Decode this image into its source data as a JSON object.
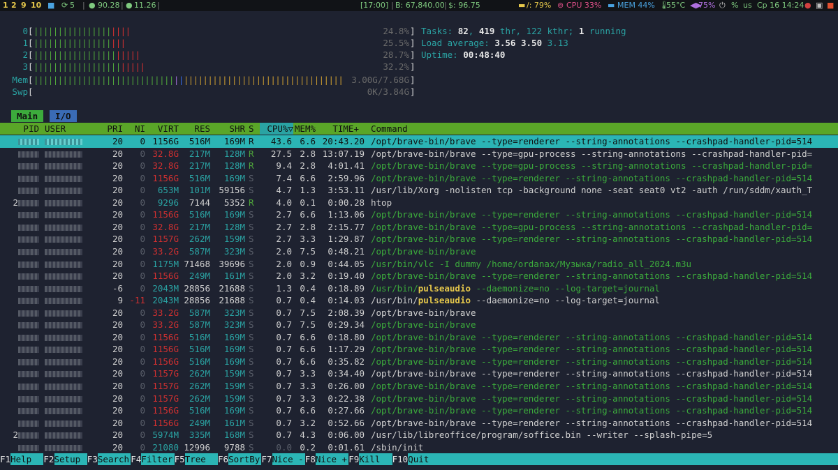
{
  "topbar": {
    "workspaces": [
      "1",
      "2",
      "9",
      "10"
    ],
    "folder_icon": "folder-icon",
    "updates": "5",
    "net_down": "90.28",
    "net_up": "11.26",
    "clock_block": "[17:00]",
    "balance": "B: 67,840.00",
    "price": "$: 96.75",
    "disk": "/: 79%",
    "cpu": "CPU 33%",
    "mem": "MEM 44%",
    "temp": "55°C",
    "battery": "75%",
    "percent_sign": "%",
    "layout": "us",
    "datetime": "Ср 16 14:24"
  },
  "meters": [
    {
      "label": "0",
      "value": "24.8%",
      "green": 16,
      "red": 4,
      "blue": 0,
      "yellow": 0
    },
    {
      "label": "1",
      "value": "25.5%",
      "green": 16,
      "red": 3,
      "blue": 0,
      "yellow": 0
    },
    {
      "label": "2",
      "value": "28.7%",
      "green": 17,
      "red": 5,
      "blue": 0,
      "yellow": 0
    },
    {
      "label": "3",
      "value": "32.2%",
      "green": 18,
      "red": 5,
      "blue": 0,
      "yellow": 0
    },
    {
      "label": "Mem",
      "value": "3.00G/7.68G",
      "green": 29,
      "red": 0,
      "blue": 1,
      "yellow": 33
    },
    {
      "label": "Swp",
      "value": "0K/3.84G",
      "green": 0,
      "red": 0,
      "blue": 0,
      "yellow": 0
    }
  ],
  "info": {
    "tasks_label": "Tasks: ",
    "tasks": "82",
    "thr": "419",
    "kthr": "122",
    "running": "1",
    "load_label": "Load average: ",
    "load1": "3.56",
    "load5": "3.50",
    "load15": "3.13",
    "uptime_label": "Uptime: ",
    "uptime": "00:48:40"
  },
  "tabs": {
    "main": "Main",
    "io": "I/O"
  },
  "header": {
    "pid": "PID",
    "user": "USER",
    "pri": "PRI",
    "ni": "NI",
    "virt": "VIRT",
    "res": "RES",
    "shr": "SHR",
    "s": "S",
    "cpu": "CPU%▽",
    "mem": "MEM%",
    "time": "TIME+",
    "cmd": "Command"
  },
  "processes": [
    {
      "pri": "20",
      "ni": "0",
      "virt": "1156G",
      "res": "516M",
      "shr": "169M",
      "s": "R",
      "cpu": "43.6",
      "mem": "6.6",
      "time": "20:43.20",
      "cmd": "/opt/brave-bin/brave --type=renderer --string-annotations --crashpad-handler-pid=514",
      "thread": false,
      "selected": true
    },
    {
      "pri": "20",
      "ni": "0",
      "virt": "32.8G",
      "res": "217M",
      "shr": "128M",
      "s": "R",
      "cpu": "27.5",
      "mem": "2.8",
      "time": "13:07.19",
      "cmd": "/opt/brave-bin/brave --type=gpu-process --string-annotations --crashpad-handler-pid=",
      "thread": false
    },
    {
      "pri": "20",
      "ni": "0",
      "virt": "32.8G",
      "res": "217M",
      "shr": "128M",
      "s": "R",
      "cpu": "9.4",
      "mem": "2.8",
      "time": "4:01.41",
      "cmd": "/opt/brave-bin/brave --type=gpu-process --string-annotations --crashpad-handler-pid=",
      "thread": true
    },
    {
      "pri": "20",
      "ni": "0",
      "virt": "1156G",
      "res": "516M",
      "shr": "169M",
      "s": "S",
      "cpu": "7.4",
      "mem": "6.6",
      "time": "2:59.96",
      "cmd": "/opt/brave-bin/brave --type=renderer --string-annotations --crashpad-handler-pid=514",
      "thread": true
    },
    {
      "pri": "20",
      "ni": "0",
      "virt": "653M",
      "res": "101M",
      "shr": "59156",
      "s": "S",
      "cpu": "4.7",
      "mem": "1.3",
      "time": "3:53.11",
      "cmd": "/usr/lib/Xorg -nolisten tcp -background none -seat seat0 vt2 -auth /run/sddm/xauth_T",
      "thread": false
    },
    {
      "pid_prefix": "2",
      "pri": "20",
      "ni": "0",
      "virt": "9296",
      "res": "7144",
      "shr": "5352",
      "s": "R",
      "cpu": "4.0",
      "mem": "0.1",
      "time": "0:00.28",
      "cmd": "htop",
      "thread": false
    },
    {
      "pri": "20",
      "ni": "0",
      "virt": "1156G",
      "res": "516M",
      "shr": "169M",
      "s": "S",
      "cpu": "2.7",
      "mem": "6.6",
      "time": "1:13.06",
      "cmd": "/opt/brave-bin/brave --type=renderer --string-annotations --crashpad-handler-pid=514",
      "thread": true
    },
    {
      "pri": "20",
      "ni": "0",
      "virt": "32.8G",
      "res": "217M",
      "shr": "128M",
      "s": "S",
      "cpu": "2.7",
      "mem": "2.8",
      "time": "2:15.77",
      "cmd": "/opt/brave-bin/brave --type=gpu-process --string-annotations --crashpad-handler-pid=",
      "thread": true
    },
    {
      "pri": "20",
      "ni": "0",
      "virt": "1157G",
      "res": "262M",
      "shr": "159M",
      "s": "S",
      "cpu": "2.7",
      "mem": "3.3",
      "time": "1:29.87",
      "cmd": "/opt/brave-bin/brave --type=renderer --string-annotations --crashpad-handler-pid=514",
      "thread": true
    },
    {
      "pri": "20",
      "ni": "0",
      "virt": "33.2G",
      "res": "587M",
      "shr": "323M",
      "s": "S",
      "cpu": "2.0",
      "mem": "7.5",
      "time": "0:48.21",
      "cmd": "/opt/brave-bin/brave",
      "thread": true
    },
    {
      "pri": "20",
      "ni": "0",
      "virt": "1175M",
      "res": "71468",
      "shr": "39696",
      "s": "S",
      "cpu": "2.0",
      "mem": "0.9",
      "time": "0:44.05",
      "cmd": "/usr/bin/vlc -I dummy /home/ordanax/Музыка/radio_all_2024.m3u",
      "thread": true
    },
    {
      "pri": "20",
      "ni": "0",
      "virt": "1156G",
      "res": "249M",
      "shr": "161M",
      "s": "S",
      "cpu": "2.0",
      "mem": "3.2",
      "time": "0:19.40",
      "cmd": "/opt/brave-bin/brave --type=renderer --string-annotations --crashpad-handler-pid=514",
      "thread": true
    },
    {
      "pri": "-6",
      "ni": "0",
      "virt": "2043M",
      "res": "28856",
      "shr": "21688",
      "s": "S",
      "cpu": "1.3",
      "mem": "0.4",
      "time": "0:18.89",
      "cmd_pre": "/usr/bin/",
      "cmd_hl": "pulseaudio",
      "cmd_post": " --daemonize=no --log-target=journal",
      "thread": true
    },
    {
      "pri": "9",
      "ni": "-11",
      "virt": "2043M",
      "res": "28856",
      "shr": "21688",
      "s": "S",
      "cpu": "0.7",
      "mem": "0.4",
      "time": "0:14.03",
      "cmd_pre": "/usr/bin/",
      "cmd_hl": "pulseaudio",
      "cmd_post": " --daemonize=no --log-target=journal",
      "thread": false
    },
    {
      "pri": "20",
      "ni": "0",
      "virt": "33.2G",
      "res": "587M",
      "shr": "323M",
      "s": "S",
      "cpu": "0.7",
      "mem": "7.5",
      "time": "2:08.39",
      "cmd": "/opt/brave-bin/brave",
      "thread": false
    },
    {
      "pri": "20",
      "ni": "0",
      "virt": "33.2G",
      "res": "587M",
      "shr": "323M",
      "s": "S",
      "cpu": "0.7",
      "mem": "7.5",
      "time": "0:29.34",
      "cmd": "/opt/brave-bin/brave",
      "thread": true
    },
    {
      "pri": "20",
      "ni": "0",
      "virt": "1156G",
      "res": "516M",
      "shr": "169M",
      "s": "S",
      "cpu": "0.7",
      "mem": "6.6",
      "time": "0:18.80",
      "cmd": "/opt/brave-bin/brave --type=renderer --string-annotations --crashpad-handler-pid=514",
      "thread": true
    },
    {
      "pri": "20",
      "ni": "0",
      "virt": "1156G",
      "res": "516M",
      "shr": "169M",
      "s": "S",
      "cpu": "0.7",
      "mem": "6.6",
      "time": "1:17.29",
      "cmd": "/opt/brave-bin/brave --type=renderer --string-annotations --crashpad-handler-pid=514",
      "thread": true
    },
    {
      "pri": "20",
      "ni": "0",
      "virt": "1156G",
      "res": "516M",
      "shr": "169M",
      "s": "S",
      "cpu": "0.7",
      "mem": "6.6",
      "time": "0:35.82",
      "cmd": "/opt/brave-bin/brave --type=renderer --string-annotations --crashpad-handler-pid=514",
      "thread": true
    },
    {
      "pri": "20",
      "ni": "0",
      "virt": "1157G",
      "res": "262M",
      "shr": "159M",
      "s": "S",
      "cpu": "0.7",
      "mem": "3.3",
      "time": "0:34.40",
      "cmd": "/opt/brave-bin/brave --type=renderer --string-annotations --crashpad-handler-pid=514",
      "thread": false
    },
    {
      "pri": "20",
      "ni": "0",
      "virt": "1157G",
      "res": "262M",
      "shr": "159M",
      "s": "S",
      "cpu": "0.7",
      "mem": "3.3",
      "time": "0:26.00",
      "cmd": "/opt/brave-bin/brave --type=renderer --string-annotations --crashpad-handler-pid=514",
      "thread": true
    },
    {
      "pri": "20",
      "ni": "0",
      "virt": "1157G",
      "res": "262M",
      "shr": "159M",
      "s": "S",
      "cpu": "0.7",
      "mem": "3.3",
      "time": "0:22.38",
      "cmd": "/opt/brave-bin/brave --type=renderer --string-annotations --crashpad-handler-pid=514",
      "thread": true
    },
    {
      "pri": "20",
      "ni": "0",
      "virt": "1156G",
      "res": "516M",
      "shr": "169M",
      "s": "S",
      "cpu": "0.7",
      "mem": "6.6",
      "time": "0:27.66",
      "cmd": "/opt/brave-bin/brave --type=renderer --string-annotations --crashpad-handler-pid=514",
      "thread": true
    },
    {
      "pri": "20",
      "ni": "0",
      "virt": "1156G",
      "res": "249M",
      "shr": "161M",
      "s": "S",
      "cpu": "0.7",
      "mem": "3.2",
      "time": "0:52.66",
      "cmd": "/opt/brave-bin/brave --type=renderer --string-annotations --crashpad-handler-pid=514",
      "thread": false
    },
    {
      "pid_prefix": "2",
      "pri": "20",
      "ni": "0",
      "virt": "5974M",
      "res": "335M",
      "shr": "168M",
      "s": "S",
      "cpu": "0.7",
      "mem": "4.3",
      "time": "0:06.00",
      "cmd": "/usr/lib/libreoffice/program/soffice.bin --writer --splash-pipe=5",
      "thread": false
    },
    {
      "pri": "20",
      "ni": "0",
      "virt": "21080",
      "res": "12996",
      "shr": "9788",
      "s": "S",
      "cpu": "0.0",
      "mem": "0.2",
      "time": "0:01.61",
      "cmd": "/sbin/init",
      "thread": false
    }
  ],
  "footer": [
    {
      "key": "F1",
      "label": "Help  "
    },
    {
      "key": "F2",
      "label": "Setup "
    },
    {
      "key": "F3",
      "label": "Search"
    },
    {
      "key": "F4",
      "label": "Filter"
    },
    {
      "key": "F5",
      "label": "Tree  "
    },
    {
      "key": "F6",
      "label": "SortBy"
    },
    {
      "key": "F7",
      "label": "Nice -"
    },
    {
      "key": "F8",
      "label": "Nice +"
    },
    {
      "key": "F9",
      "label": "Kill  "
    },
    {
      "key": "F10",
      "label": "Quit"
    }
  ],
  "colors": {
    "accent": "#2aa3a3",
    "header_bg": "#5aa628",
    "selection": "#2bb5b5",
    "thread": "#3cab3c",
    "bg": "#1e2230"
  }
}
